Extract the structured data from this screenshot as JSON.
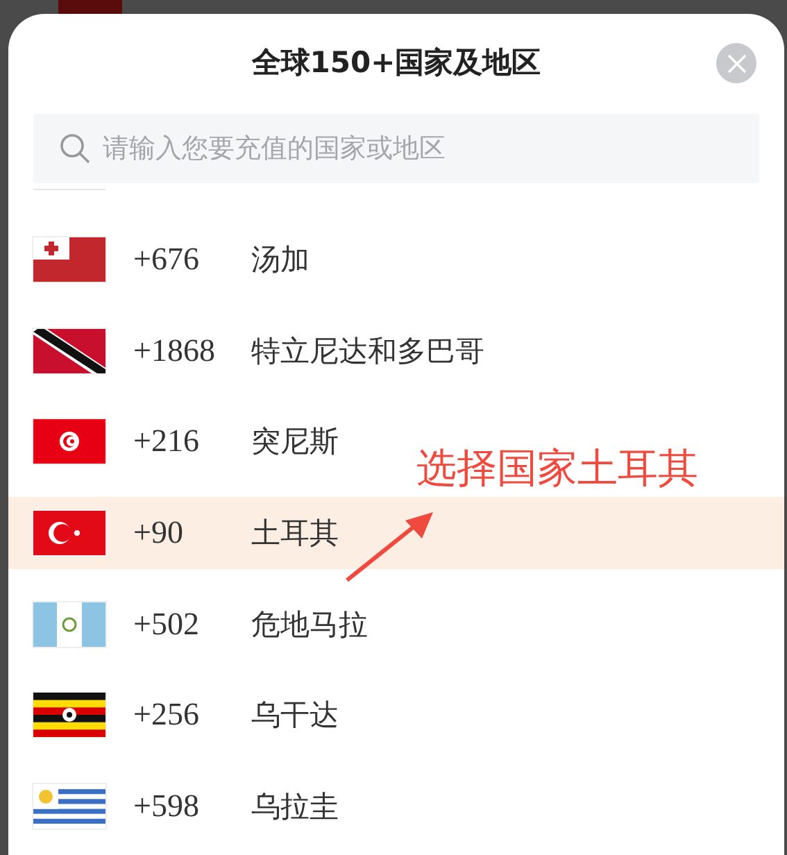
{
  "sheet": {
    "title": "全球150+国家及地区",
    "search": {
      "placeholder": "请输入您要充值的国家或地区"
    }
  },
  "countries": [
    {
      "kind": "tonga",
      "code": "+676",
      "name": "汤加",
      "selected": false
    },
    {
      "kind": "trinidad",
      "code": "+1868",
      "name": "特立尼达和多巴哥",
      "selected": false
    },
    {
      "kind": "tunisia",
      "code": "+216",
      "name": "突尼斯",
      "selected": false
    },
    {
      "kind": "turkey",
      "code": "+90",
      "name": "土耳其",
      "selected": true
    },
    {
      "kind": "guatemala",
      "code": "+502",
      "name": "危地马拉",
      "selected": false
    },
    {
      "kind": "uganda",
      "code": "+256",
      "name": "乌干达",
      "selected": false
    },
    {
      "kind": "uruguay",
      "code": "+598",
      "name": "乌拉圭",
      "selected": false
    }
  ],
  "annotation": {
    "text": "选择国家土耳其"
  }
}
